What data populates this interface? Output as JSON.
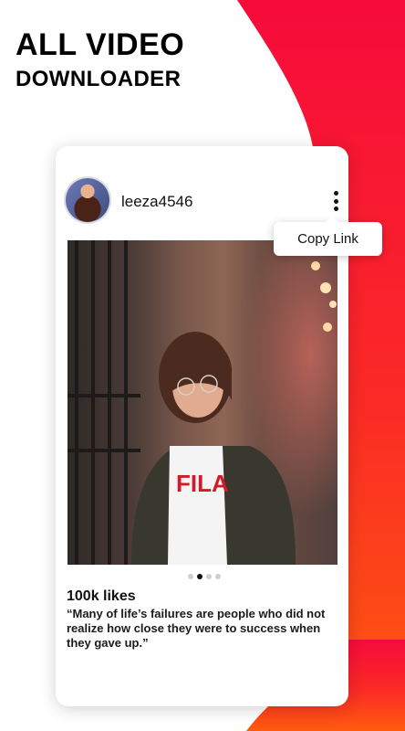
{
  "headline": {
    "line1": "ALL VIDEO",
    "line2": "DOWNLOADER"
  },
  "colors": {
    "accent_red": "#f20f3d",
    "accent_orange": "#ff5a10",
    "card_bg": "#ffffff"
  },
  "post": {
    "username": "leeza4546",
    "avatar_icon": "user-avatar-photo",
    "menu_icon": "kebab-menu-icon",
    "menu_popup": {
      "copy_link_label": "Copy Link"
    },
    "image_icon": "portrait-photo",
    "carousel": {
      "total": 4,
      "active": 2
    },
    "likes": "100k likes",
    "caption": "“Many of life’s failures are people who did not realize how close they were to success when they gave up.”"
  }
}
